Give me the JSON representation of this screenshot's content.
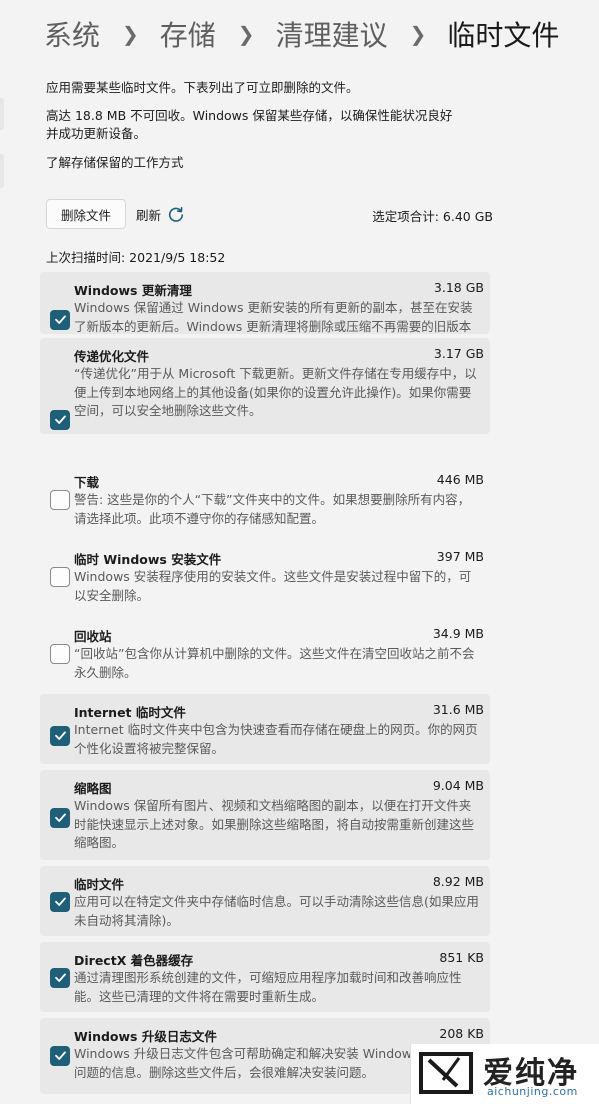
{
  "breadcrumb": [
    "系统",
    "存储",
    "清理建议",
    "临时文件"
  ],
  "intro_text": "应用需要某些临时文件。下表列出了可立即删除的文件。",
  "reserved_text_line1": "高达 18.8 MB 不可回收。Windows 保留某些存储，以确保性能状况良好",
  "reserved_text_line2": "并成功更新设备。",
  "learn_link": "了解存储保留的工作方式",
  "delete_button": "删除文件",
  "refresh_label": "刷新",
  "selected_total": "选定项合计: 6.40 GB",
  "last_scan": "上次扫描时间: 2021/9/5 18:52",
  "items": [
    {
      "title": "Windows 更新清理",
      "size": "3.18 GB",
      "checked": true,
      "desc": "Windows 保留通过 Windows 更新安装的所有更新的副本，甚至在安装了新版本的更新后。Windows 更新清理将删除或压缩不再需要的旧版本更新以免占用空间。(你可能需要重新启动计算机。)"
    },
    {
      "title": "传递优化文件",
      "size": "3.17 GB",
      "checked": true,
      "desc": "“传递优化”用于从 Microsoft 下载更新。更新文件存储在专用缓存中，以便上传到本地网络上的其他设备(如果你的设置允许此操作)。如果你需要空间，可以安全地删除这些文件。"
    },
    {
      "title": "下载",
      "size": "446 MB",
      "checked": false,
      "desc": "警告: 这些是你的个人“下载”文件夹中的文件。如果想要删除所有内容，请选择此项。此项不遵守你的存储感知配置。"
    },
    {
      "title": "临时 Windows 安装文件",
      "size": "397 MB",
      "checked": false,
      "desc": "Windows 安装程序使用的安装文件。这些文件是安装过程中留下的，可以安全删除。"
    },
    {
      "title": "回收站",
      "size": "34.9 MB",
      "checked": false,
      "desc": "“回收站”包含你从计算机中删除的文件。这些文件在清空回收站之前不会永久删除。"
    },
    {
      "title": "Internet 临时文件",
      "size": "31.6 MB",
      "checked": true,
      "desc": "Internet 临时文件夹中包含为快速查看而存储在硬盘上的网页。你的网页个性化设置将被完整保留。"
    },
    {
      "title": "缩略图",
      "size": "9.04 MB",
      "checked": true,
      "desc": "Windows 保留所有图片、视频和文档缩略图的副本，以便在打开文件夹时能快速显示上述对象。如果删除这些缩略图，将自动按需重新创建这些缩略图。"
    },
    {
      "title": "临时文件",
      "size": "8.92 MB",
      "checked": true,
      "desc": "应用可以在特定文件夹中存储临时信息。可以手动清除这些信息(如果应用未自动将其清除)。"
    },
    {
      "title": "DirectX 着色器缓存",
      "size": "851 KB",
      "checked": true,
      "desc": "通过清理图形系统创建的文件，可缩短应用程序加载时间和改善响应性能。这些已清理的文件将在需要时重新生成。"
    },
    {
      "title": "Windows 升级日志文件",
      "size": "208 KB",
      "checked": true,
      "desc": "Windows 升级日志文件包含可帮助确定和解决安装 Windows 时发生的问题的信息。删除这些文件后，会很难解决安装问题。"
    }
  ],
  "watermark": {
    "text": "爱纯净",
    "url": "aichunjing.com"
  },
  "colors": {
    "accent": "#1f5f78",
    "checked_bg": "#e8e8e8",
    "page_bg": "#f3f3f3"
  }
}
